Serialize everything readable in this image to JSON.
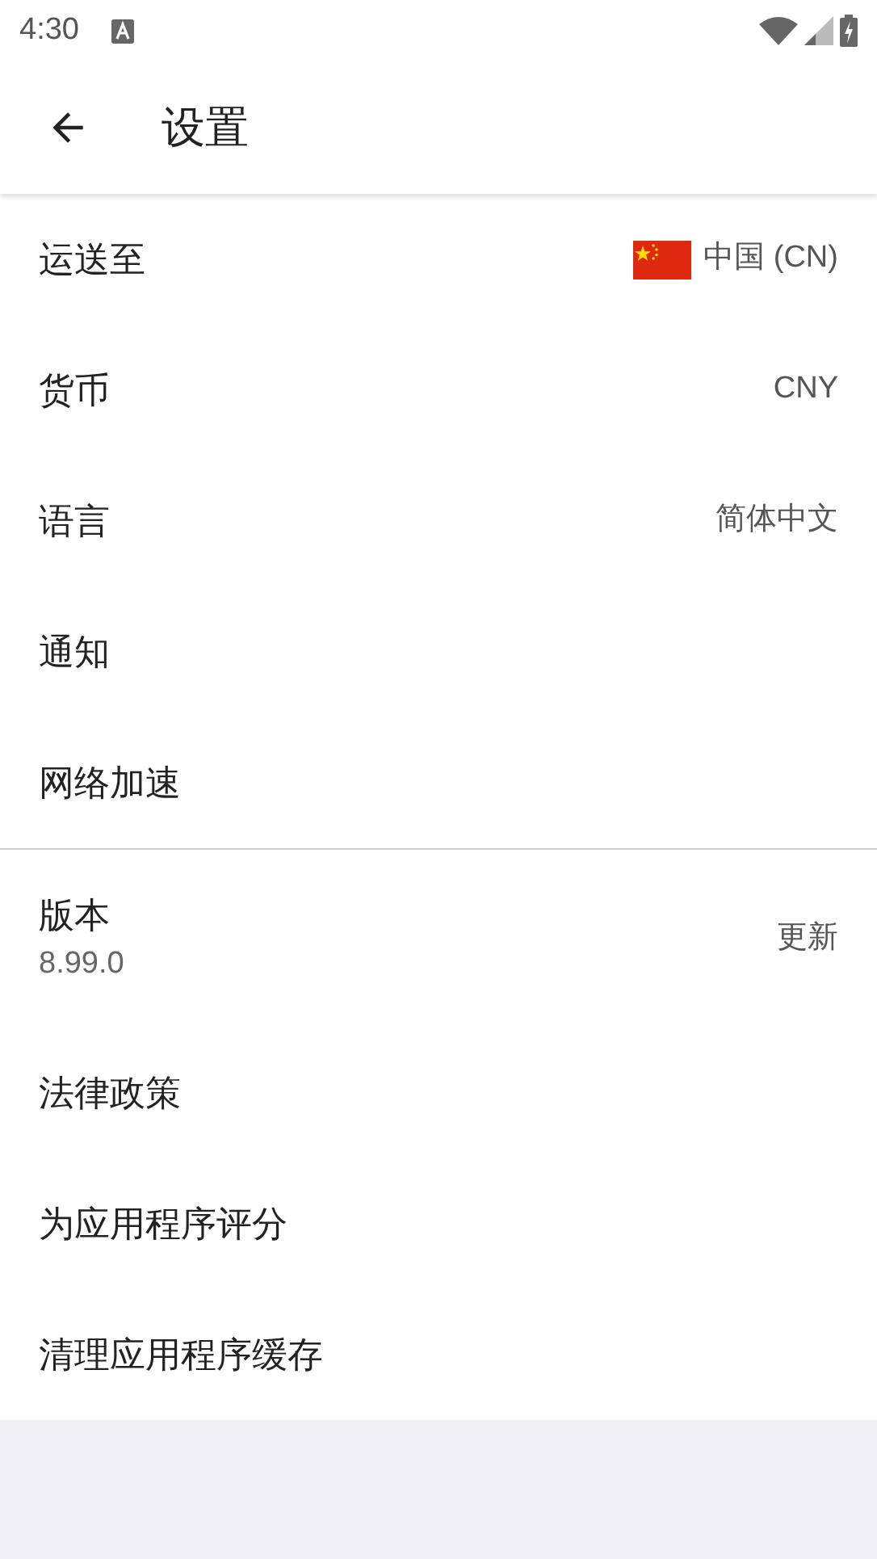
{
  "status_bar": {
    "time": "4:30"
  },
  "toolbar": {
    "title": "设置"
  },
  "sections": [
    {
      "items": [
        {
          "kind": "flag",
          "label": "运送至",
          "value": "中国 (CN)"
        },
        {
          "kind": "value",
          "label": "货币",
          "value": "CNY"
        },
        {
          "kind": "value",
          "label": "语言",
          "value": "简体中文"
        },
        {
          "kind": "plain",
          "label": "通知"
        },
        {
          "kind": "plain",
          "label": "网络加速"
        }
      ]
    },
    {
      "items": [
        {
          "kind": "subtitle",
          "label": "版本",
          "subtitle": "8.99.0",
          "value": "更新"
        },
        {
          "kind": "plain",
          "label": "法律政策"
        },
        {
          "kind": "plain",
          "label": "为应用程序评分"
        },
        {
          "kind": "plain",
          "label": "清理应用程序缓存"
        }
      ]
    }
  ]
}
